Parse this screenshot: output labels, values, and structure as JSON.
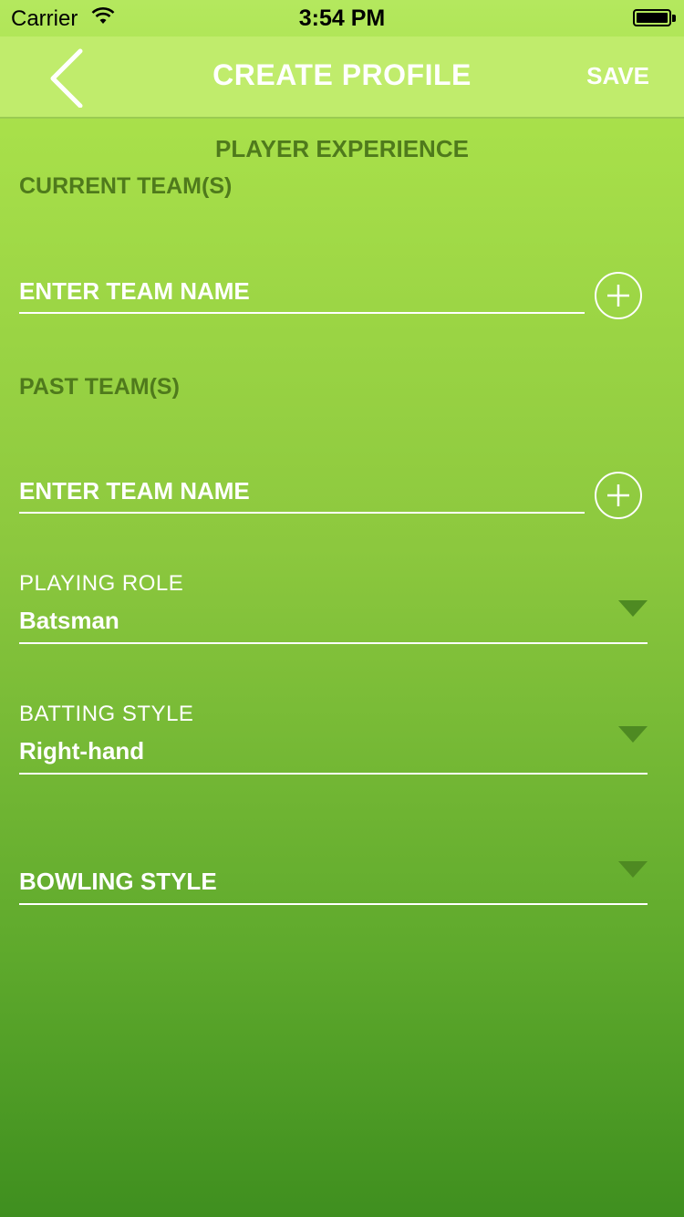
{
  "status_bar": {
    "carrier": "Carrier",
    "time": "3:54 PM"
  },
  "nav": {
    "title": "CREATE PROFILE",
    "save_label": "SAVE"
  },
  "section_title": "PLAYER EXPERIENCE",
  "current_teams": {
    "label": "CURRENT TEAM(S)",
    "placeholder": "ENTER TEAM NAME"
  },
  "past_teams": {
    "label": "PAST TEAM(S)",
    "placeholder": "ENTER TEAM NAME"
  },
  "playing_role": {
    "label": "PLAYING ROLE",
    "value": "Batsman"
  },
  "batting_style": {
    "label": "BATTING STYLE",
    "value": "Right-hand"
  },
  "bowling_style": {
    "placeholder": "BOWLING STYLE"
  },
  "icons": {
    "back": "chevron-left-icon",
    "add": "plus-circle-icon",
    "dropdown": "triangle-down-icon",
    "wifi": "wifi-icon",
    "battery": "battery-icon"
  },
  "colors": {
    "nav_background": "#c0ec6c",
    "label_dark_green": "#4f7a1c",
    "dropdown_arrow": "#4e8a22"
  }
}
